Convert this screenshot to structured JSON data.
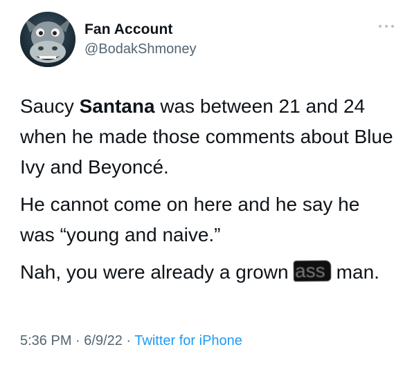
{
  "author": {
    "display_name": "Fan Account",
    "handle": "@BodakShmoney",
    "avatar_icon": "donkey-avatar-icon"
  },
  "more_icon": "more-options-icon",
  "tweet": {
    "paragraph1": {
      "part1": "Saucy ",
      "bold": "Santana",
      "part2": " was between 21 and 24 when he made those comments about Blue Ivy and Beyoncé."
    },
    "paragraph2": "He cannot come on here and he say he was “young and naive.”",
    "paragraph3": {
      "part1": "Nah, you were already a grown ",
      "censored": "ass",
      "part2": " man."
    }
  },
  "meta": {
    "time": "5:36 PM",
    "separator": " · ",
    "date": "6/9/22",
    "source": "Twitter for iPhone"
  },
  "colors": {
    "text": "#0f1419",
    "secondary": "#536471",
    "link": "#1d9bf0",
    "censor_bar": "#0f0f0f"
  }
}
